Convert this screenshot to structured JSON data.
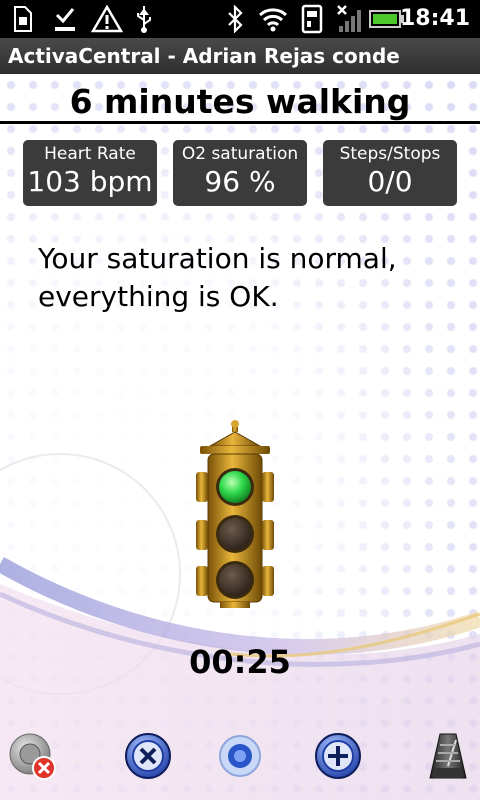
{
  "status_bar": {
    "time": "18:41",
    "icons": [
      "sim-card-icon",
      "download-complete-icon",
      "warning-icon",
      "usb-icon",
      "bluetooth-icon",
      "wifi-icon",
      "phone-storage-icon",
      "no-signal-icon",
      "battery-icon"
    ]
  },
  "app": {
    "title": "ActivaCentral - Adrian Rejas conde"
  },
  "screen": {
    "heading": "6 minutes walking",
    "message": "Your saturation is normal, everything is OK.",
    "timer": "00:25"
  },
  "metrics": [
    {
      "label": "Heart Rate",
      "value": "103 bpm"
    },
    {
      "label": "O2 saturation",
      "value": "96 %"
    },
    {
      "label": "Steps/Stops",
      "value": "0/0"
    }
  ],
  "traffic_light": {
    "active_light": "top",
    "active_color": "#2fd84a"
  },
  "toolbar": {
    "buttons": [
      "volume-off-icon",
      "stop-icon",
      "record-icon",
      "add-icon",
      "metronome-icon"
    ]
  },
  "colors": {
    "metric_bg": "#3b3b3b",
    "accent_blue": "#2a55c8",
    "traffic_body": "#c8961e"
  }
}
